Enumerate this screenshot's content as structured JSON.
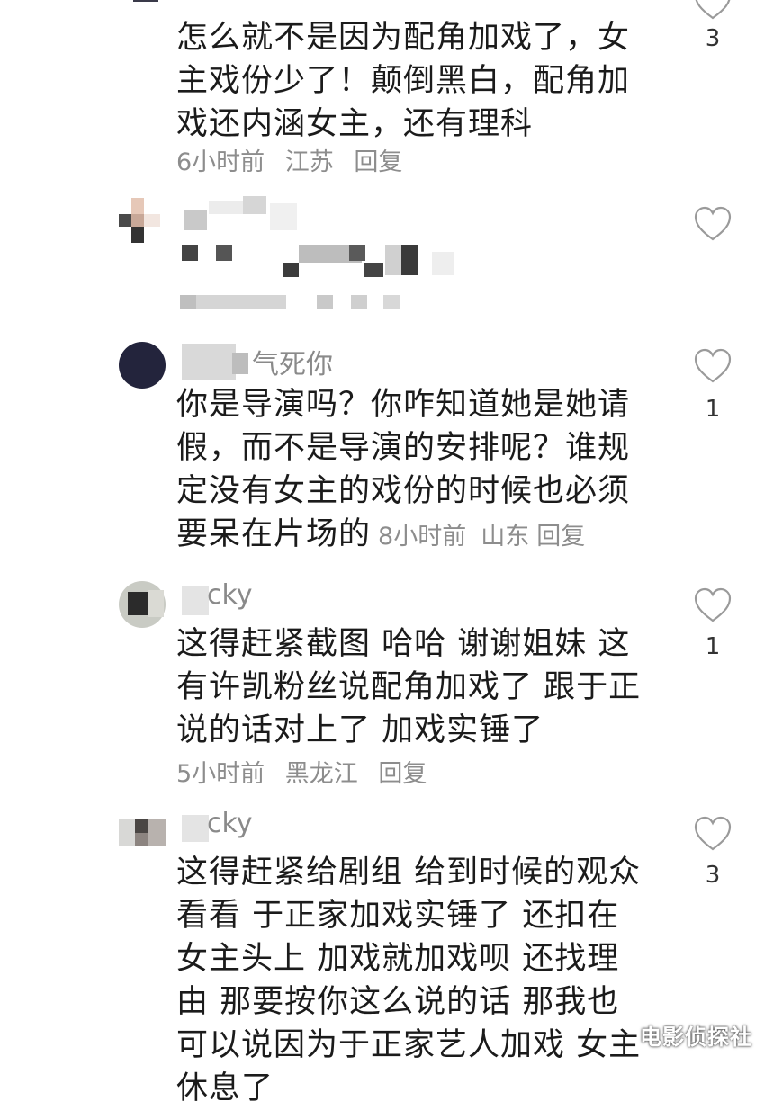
{
  "comments": [
    {
      "text": "怎么就不是因为配角加戏了，女主戏份少了！颠倒黑白，配角加戏还内涵女主，还有理科",
      "time": "6小时前",
      "location": "江苏",
      "reply_label": "回复",
      "likes": "3"
    },
    {
      "name": "",
      "text": "",
      "likes": ""
    },
    {
      "name": "气死你",
      "text": "你是导演吗？你咋知道她是她请假，而不是导演的安排呢？谁规定没有女主的戏份的时候也必须要呆在片场的",
      "time": "8小时前",
      "location": "山东",
      "reply_label": "回复",
      "likes": "1"
    },
    {
      "name": "cky",
      "text": "这得赶紧截图 哈哈 谢谢姐妹 这有许凯粉丝说配角加戏了 跟于正说的话对上了 加戏实锤了",
      "time": "5小时前",
      "location": "黑龙江",
      "reply_label": "回复",
      "likes": "1"
    },
    {
      "name": "cky",
      "text": "这得赶紧给剧组 给到时候的观众看看 于正家加戏实锤了 还扣在女主头上 加戏就加戏呗 还找理由 那要按你这么说的话 那我也可以说因为于正家艺人加戏 女主休息了",
      "likes": "3"
    }
  ],
  "watermark": "电影侦探社",
  "icons": {
    "like": "heart-outline-icon"
  }
}
